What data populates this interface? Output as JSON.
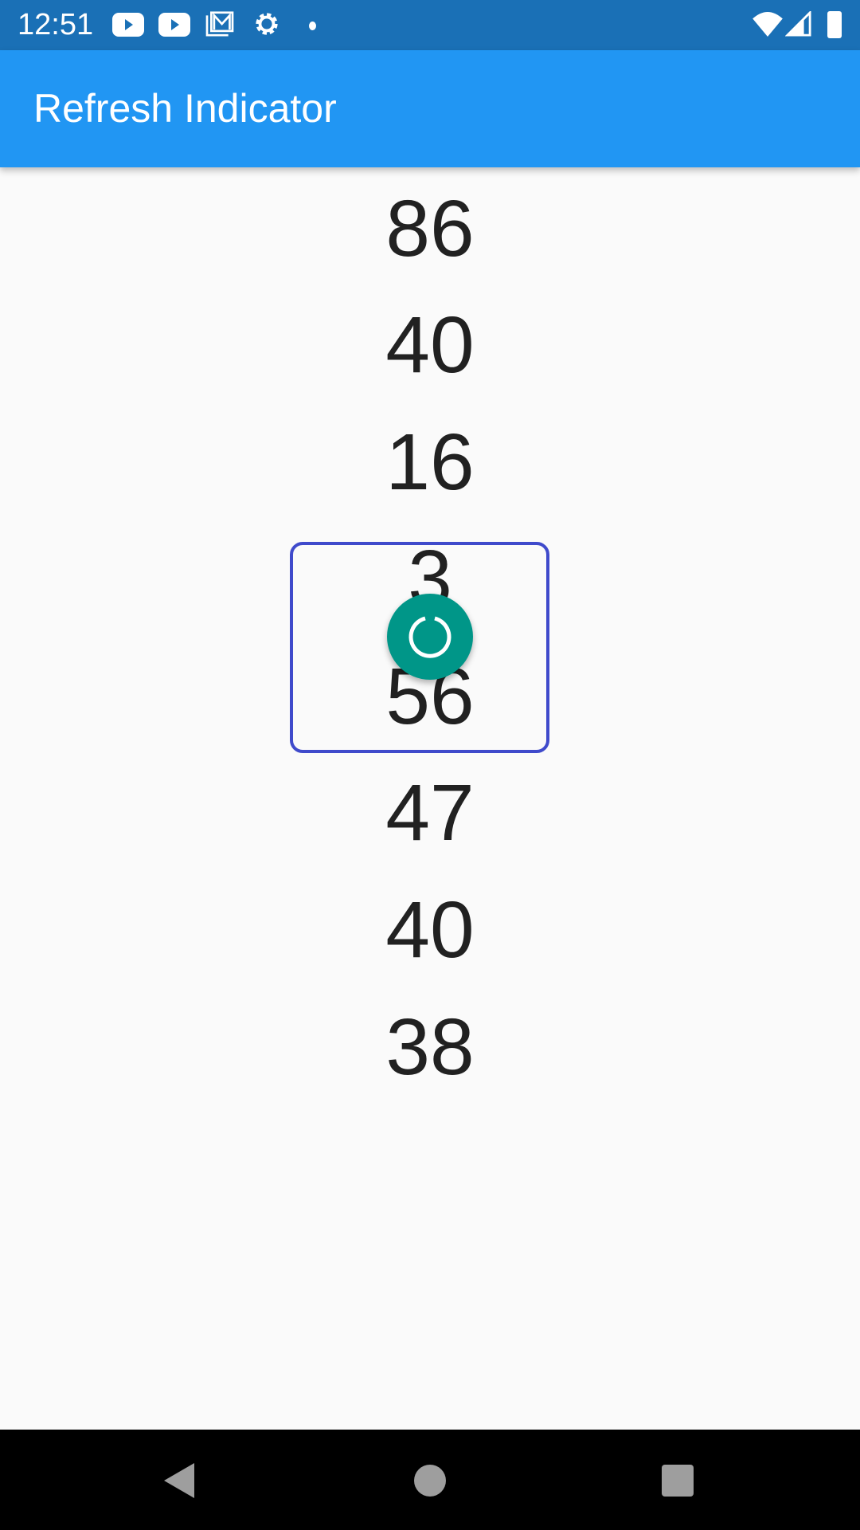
{
  "status_bar": {
    "time": "12:51",
    "icons": [
      "youtube-icon",
      "youtube-icon",
      "gmail-icon",
      "settings-icon",
      "dot-icon",
      "wifi-icon",
      "signal-icon",
      "battery-icon"
    ]
  },
  "app_bar": {
    "title": "Refresh Indicator",
    "color": "#2196f3"
  },
  "list": {
    "items": [
      "86",
      "40",
      "16",
      "3",
      "56",
      "47",
      "40",
      "38"
    ]
  },
  "refresh_indicator": {
    "color": "#009688",
    "state": "refreshing"
  },
  "nav_bar": {
    "buttons": [
      "back",
      "home",
      "recents"
    ]
  }
}
